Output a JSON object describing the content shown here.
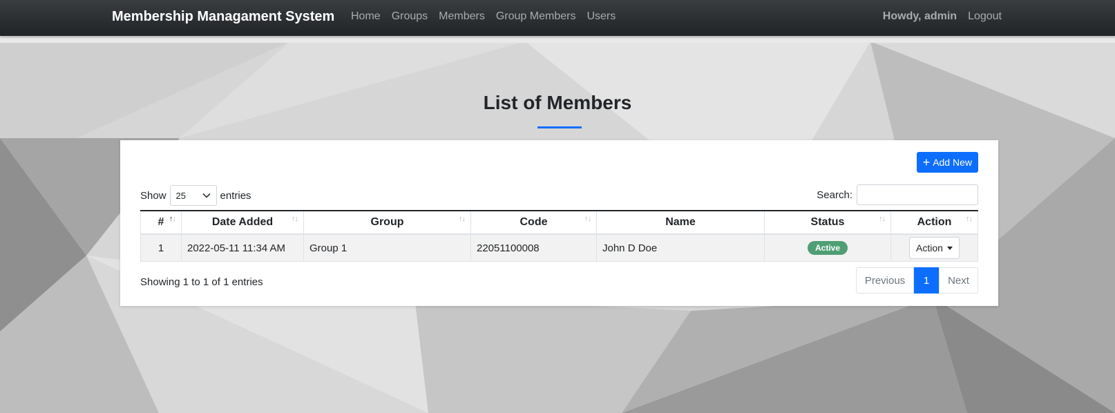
{
  "navbar": {
    "brand": "Membership Managament System",
    "links": [
      "Home",
      "Groups",
      "Members",
      "Group Members",
      "Users"
    ],
    "greeting": "Howdy, admin",
    "logout": "Logout"
  },
  "page": {
    "title": "List of Members"
  },
  "toolbar": {
    "add_new": "Add New",
    "show_label": "Show",
    "entries_label": "entries",
    "page_length": "25",
    "search_label": "Search:",
    "search_value": ""
  },
  "table": {
    "columns": [
      "#",
      "Date Added",
      "Group",
      "Code",
      "Name",
      "Status",
      "Action"
    ],
    "rows": [
      {
        "num": "1",
        "date_added": "2022-05-11 11:34 AM",
        "group": "Group 1",
        "code": "22051100008",
        "name": "John D Doe",
        "status": "Active",
        "action": "Action"
      }
    ]
  },
  "footer": {
    "info": "Showing 1 to 1 of 1 entries",
    "prev": "Previous",
    "current_page": "1",
    "next": "Next"
  },
  "colors": {
    "primary": "#0d6efd",
    "badge_active": "#4f9f74",
    "navbar": "#2b2e31"
  }
}
